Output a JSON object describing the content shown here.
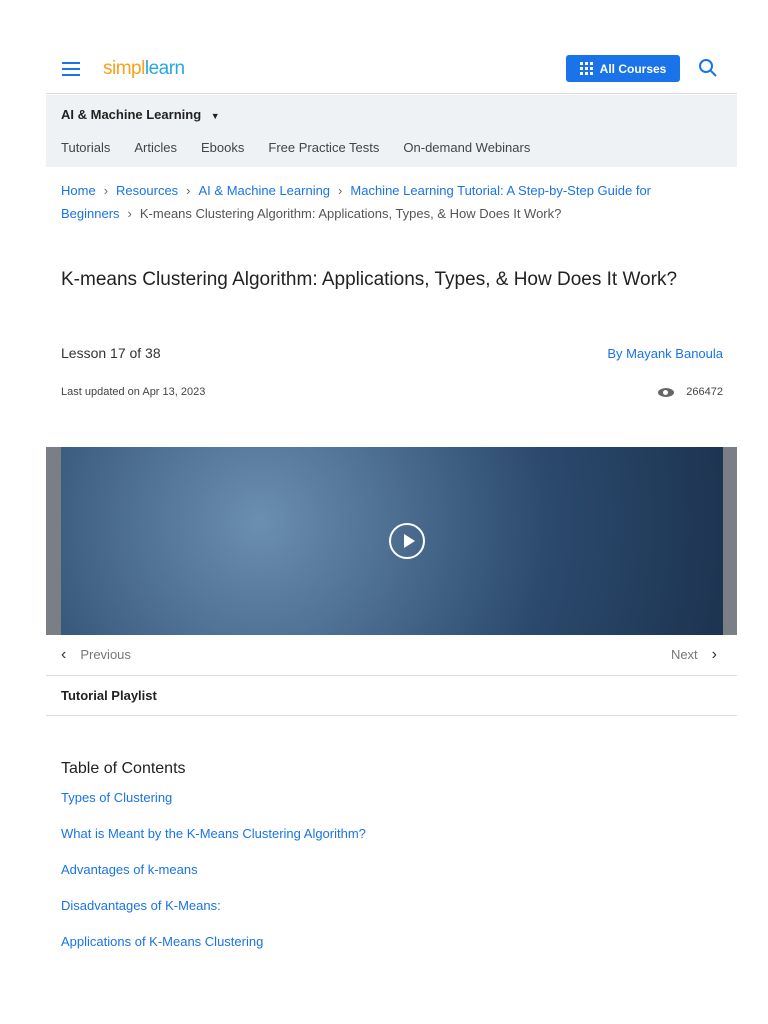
{
  "header": {
    "logo": "simplilearn",
    "logo_a": "simpl",
    "logo_b": "learn",
    "all_courses": "All Courses"
  },
  "subnav": {
    "category": "AI & Machine Learning",
    "tabs": [
      "Tutorials",
      "Articles",
      "Ebooks",
      "Free Practice Tests",
      "On-demand Webinars"
    ]
  },
  "breadcrumb": [
    "Home",
    "Resources",
    "AI & Machine Learning",
    "Machine Learning Tutorial: A Step-by-Step Guide for Beginners"
  ],
  "breadcrumb_current": "K-means Clustering Algorithm: Applications, Types, & How Does It Work?",
  "article": {
    "title": "K-means Clustering Algorithm: Applications, Types, & How Does It Work?",
    "lesson": "Lesson 17 of 38",
    "author": "By Mayank Banoula",
    "updated": "Last updated on Apr 13, 2023",
    "views": "266472"
  },
  "nav": {
    "previous": "Previous",
    "next": "Next",
    "playlist": "Tutorial Playlist"
  },
  "toc": {
    "title": "Table of Contents",
    "items": [
      "Types of Clustering",
      "What is Meant by the K-Means Clustering Algorithm?",
      "Advantages of k-means",
      "Disadvantages of K-Means:",
      "Applications of K-Means Clustering"
    ]
  }
}
